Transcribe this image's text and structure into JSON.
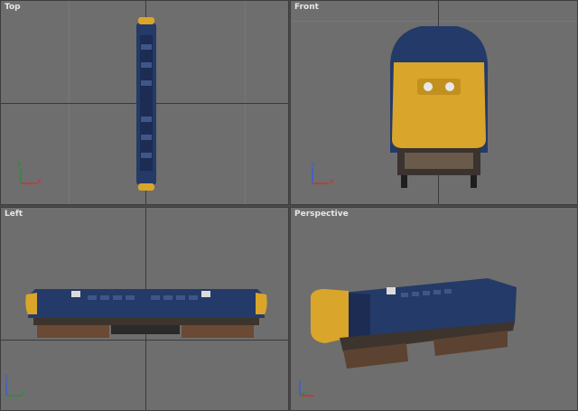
{
  "viewports": {
    "top": {
      "label": "Top"
    },
    "front": {
      "label": "Front"
    },
    "left": {
      "label": "Left"
    },
    "perspective": {
      "label": "Perspective"
    }
  },
  "axis_letters": {
    "x": "x",
    "y": "y",
    "z": "z"
  },
  "colors": {
    "background": "#6e6e6e",
    "grid_main": "#3a3a3a",
    "loco_body": "#243a68",
    "loco_nose": "#d9a52a",
    "axis_x": "#c83232",
    "axis_y": "#2e8b3a",
    "axis_z": "#3a5fd0"
  }
}
